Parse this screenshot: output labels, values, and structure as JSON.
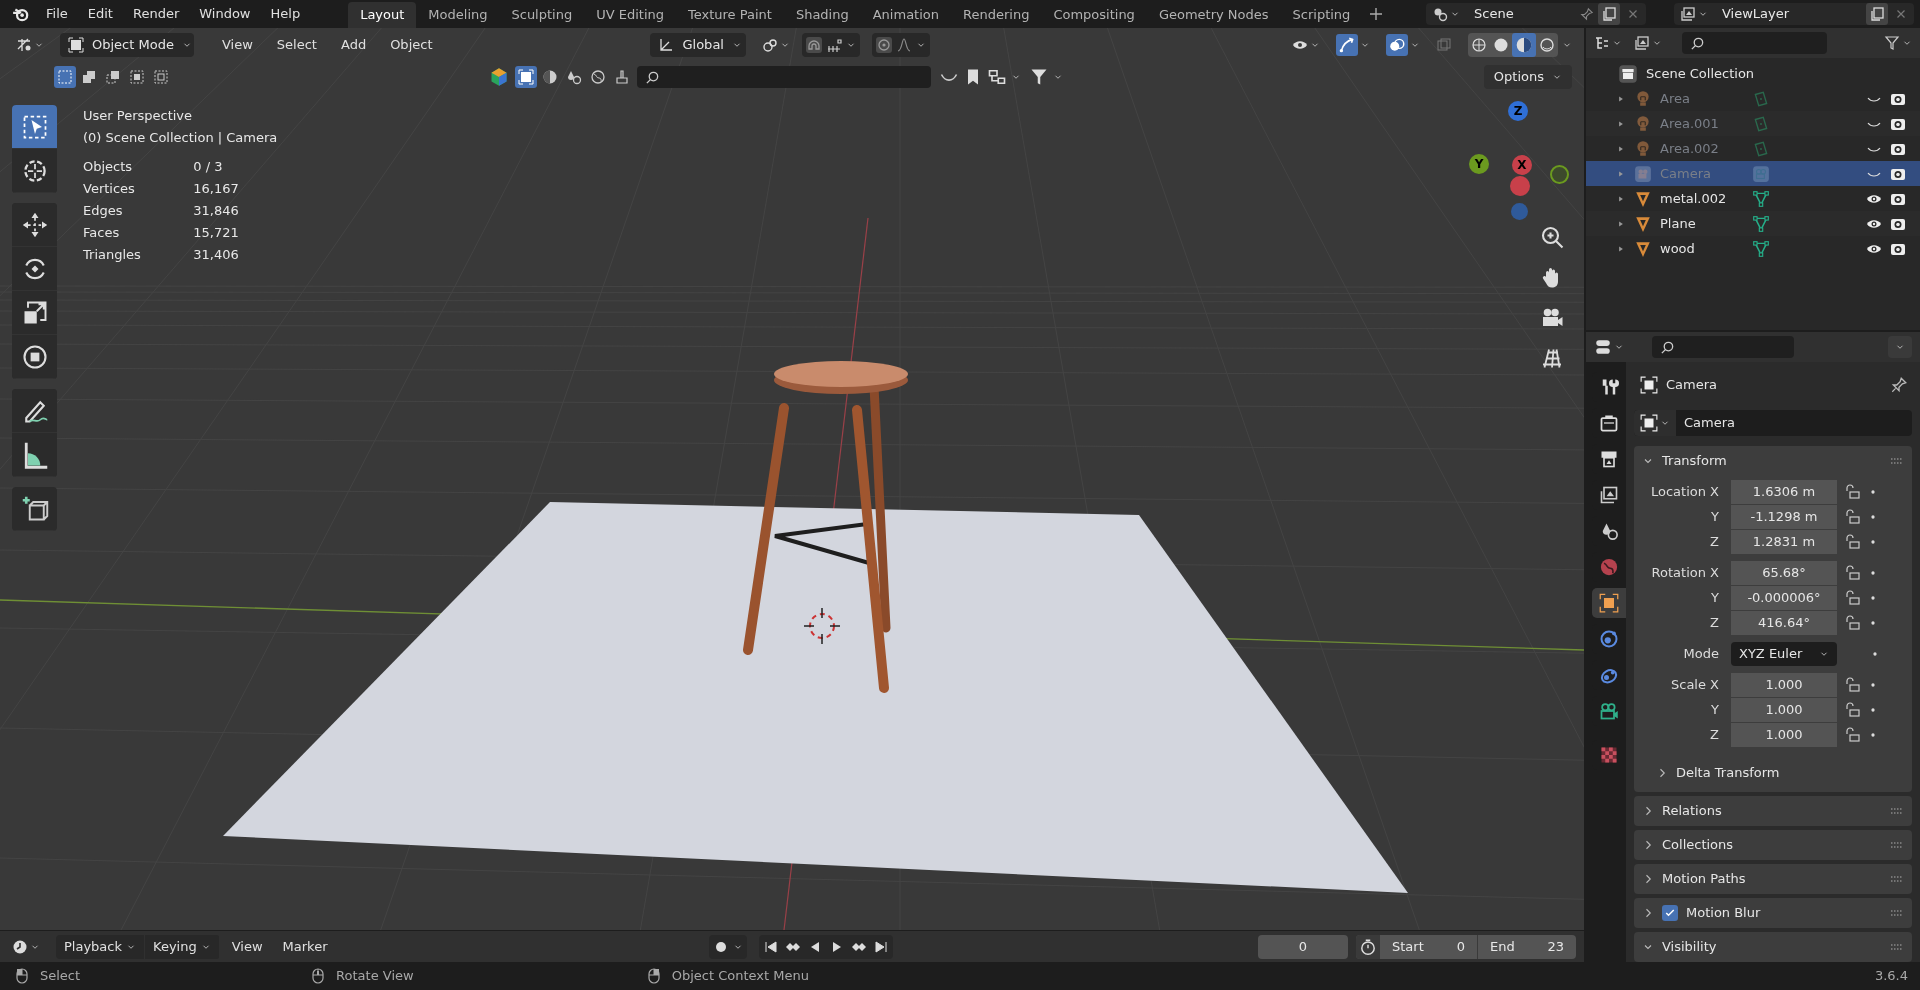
{
  "top_bar": {
    "menus": [
      "File",
      "Edit",
      "Render",
      "Window",
      "Help"
    ],
    "workspaces": [
      {
        "label": "Layout",
        "selected": true
      },
      {
        "label": "Modeling",
        "selected": false
      },
      {
        "label": "Sculpting",
        "selected": false
      },
      {
        "label": "UV Editing",
        "selected": false
      },
      {
        "label": "Texture Paint",
        "selected": false
      },
      {
        "label": "Shading",
        "selected": false
      },
      {
        "label": "Animation",
        "selected": false
      },
      {
        "label": "Rendering",
        "selected": false
      },
      {
        "label": "Compositing",
        "selected": false
      },
      {
        "label": "Geometry Nodes",
        "selected": false
      },
      {
        "label": "Scripting",
        "selected": false
      }
    ],
    "scene": "Scene",
    "view_layer": "ViewLayer"
  },
  "viewport_header": {
    "mode": "Object Mode",
    "menus": [
      "View",
      "Select",
      "Add",
      "Object"
    ],
    "orientation": "Global",
    "options": "Options"
  },
  "viewport": {
    "tool_groups": [
      [
        {
          "kind": "select",
          "selected": true
        },
        {
          "kind": "cursor",
          "selected": false
        }
      ],
      [
        {
          "kind": "move",
          "selected": false
        },
        {
          "kind": "rotate",
          "selected": false
        },
        {
          "kind": "scale",
          "selected": false
        },
        {
          "kind": "transform",
          "selected": false
        }
      ],
      [
        {
          "kind": "annotate",
          "selected": false
        },
        {
          "kind": "measure",
          "selected": false
        }
      ],
      [
        {
          "kind": "add_cube",
          "selected": false
        }
      ]
    ],
    "perspective": "User Perspective",
    "context": "(0) Scene Collection | Camera",
    "stats": [
      {
        "label": "Objects",
        "value": "0 / 3"
      },
      {
        "label": "Vertices",
        "value": "16,167"
      },
      {
        "label": "Edges",
        "value": "31,846"
      },
      {
        "label": "Faces",
        "value": "15,721"
      },
      {
        "label": "Triangles",
        "value": "31,406"
      }
    ],
    "gizmo": [
      {
        "label": "Z",
        "color": "#2f6fd6"
      },
      {
        "label": "X",
        "color": "#c8404a"
      },
      {
        "label": "Y",
        "color": "#6b9a1f"
      }
    ]
  },
  "outliner": {
    "root": "Scene Collection",
    "items": [
      {
        "name": "Area",
        "kind": "light",
        "visible": false,
        "selected": false
      },
      {
        "name": "Area.001",
        "kind": "light",
        "visible": false,
        "selected": false
      },
      {
        "name": "Area.002",
        "kind": "light",
        "visible": false,
        "selected": false
      },
      {
        "name": "Camera",
        "kind": "camera",
        "visible": false,
        "selected": true
      },
      {
        "name": "metal.002",
        "kind": "mesh",
        "visible": true,
        "selected": false
      },
      {
        "name": "Plane",
        "kind": "mesh",
        "visible": true,
        "selected": false
      },
      {
        "name": "wood",
        "kind": "mesh",
        "visible": true,
        "selected": false
      }
    ]
  },
  "properties": {
    "tabs": [
      {
        "kind": "tool",
        "selected": false
      },
      {
        "kind": "render",
        "selected": false
      },
      {
        "kind": "output",
        "selected": false
      },
      {
        "kind": "view_layer",
        "selected": false
      },
      {
        "kind": "scene",
        "selected": false
      },
      {
        "kind": "world",
        "selected": false
      },
      {
        "kind": "object",
        "selected": true
      },
      {
        "kind": "physics",
        "selected": false
      },
      {
        "kind": "constraints",
        "selected": false
      },
      {
        "kind": "data",
        "selected": false
      },
      {
        "kind": "texture",
        "selected": false
      }
    ],
    "object_name": "Camera",
    "datablock": "Camera",
    "transform": {
      "title": "Transform",
      "expanded": true,
      "groups": [
        [
          {
            "label": "Location X",
            "value": "1.6306 m"
          },
          {
            "label": "Y",
            "value": "-1.1298 m"
          },
          {
            "label": "Z",
            "value": "1.2831 m"
          }
        ],
        [
          {
            "label": "Rotation X",
            "value": "65.68°"
          },
          {
            "label": "Y",
            "value": "-0.000006°"
          },
          {
            "label": "Z",
            "value": "416.64°"
          }
        ],
        [
          {
            "label": "Mode",
            "value": "XYZ Euler",
            "kind": "dropdown"
          }
        ],
        [
          {
            "label": "Scale X",
            "value": "1.000"
          },
          {
            "label": "Y",
            "value": "1.000"
          },
          {
            "label": "Z",
            "value": "1.000"
          }
        ]
      ],
      "subpanel": {
        "title": "Delta Transform",
        "expanded": false
      }
    },
    "panels": [
      {
        "title": "Relations",
        "expanded": false
      },
      {
        "title": "Collections",
        "expanded": false
      },
      {
        "title": "Motion Paths",
        "expanded": false
      },
      {
        "title": "Motion Blur",
        "expanded": false,
        "checked": true
      },
      {
        "title": "Visibility",
        "expanded": true
      }
    ]
  },
  "timeline": {
    "menus": [
      "Playback",
      "Keying",
      "View",
      "Marker"
    ],
    "current_frame": "0",
    "start_label": "Start",
    "start": "0",
    "end_label": "End",
    "end": "23"
  },
  "status_bar": {
    "hints": [
      "Select",
      "Rotate View",
      "Object Context Menu"
    ],
    "version": "3.6.4"
  }
}
